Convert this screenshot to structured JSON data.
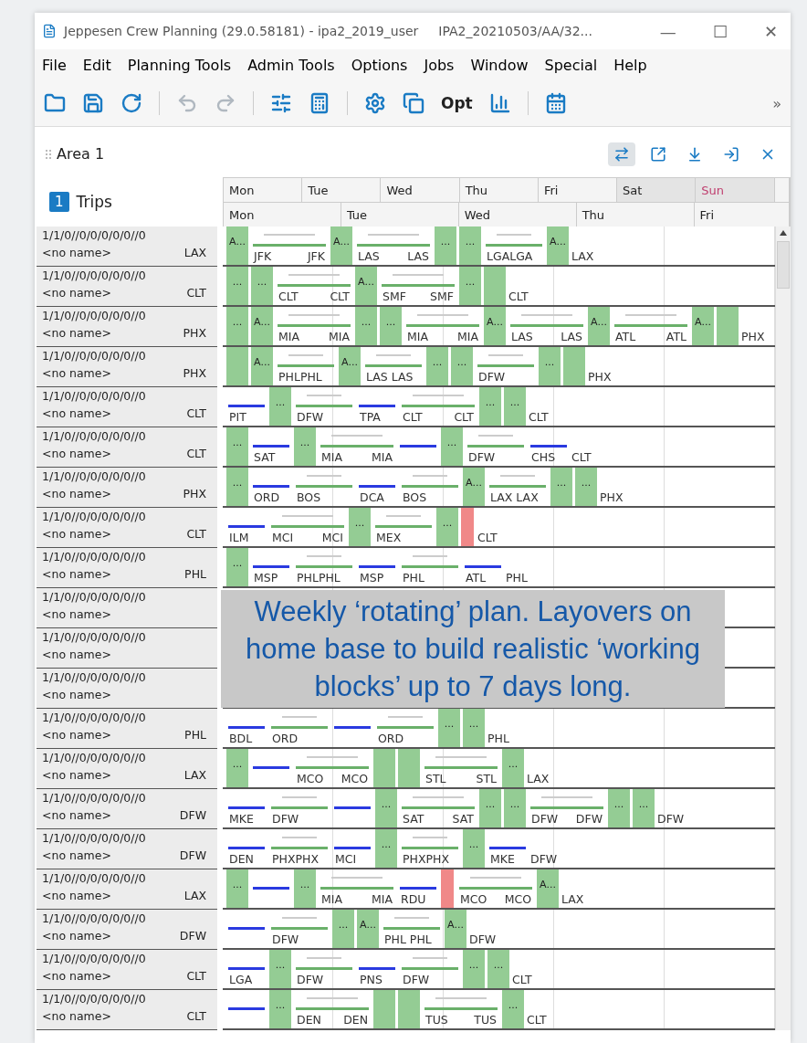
{
  "window": {
    "title": "Jeppesen Crew Planning (29.0.58181) - ipa2_2019_user",
    "subtitle": "IPA2_20210503/AA/32...",
    "controls": [
      "—",
      "☐",
      "✕"
    ]
  },
  "menu": [
    "File",
    "Edit",
    "Planning Tools",
    "Admin Tools",
    "Options",
    "Jobs",
    "Window",
    "Special",
    "Help"
  ],
  "toolbar": {
    "items": [
      {
        "kind": "icon",
        "disabled": false
      },
      {
        "kind": "icon",
        "disabled": false
      },
      {
        "kind": "icon",
        "disabled": false
      },
      {
        "kind": "sep"
      },
      {
        "kind": "icon",
        "disabled": true
      },
      {
        "kind": "icon",
        "disabled": true
      },
      {
        "kind": "sep"
      },
      {
        "kind": "icon",
        "disabled": false
      },
      {
        "kind": "icon",
        "disabled": false
      },
      {
        "kind": "sep"
      },
      {
        "kind": "icon",
        "disabled": false
      },
      {
        "kind": "icon",
        "disabled": false
      },
      {
        "kind": "text",
        "label": "Opt"
      },
      {
        "kind": "icon",
        "disabled": false
      },
      {
        "kind": "sep"
      },
      {
        "kind": "icon",
        "disabled": false
      }
    ],
    "overflow": "»"
  },
  "area": {
    "title": "Area 1",
    "actions": [
      {
        "selected": true
      },
      {
        "selected": false
      },
      {
        "selected": false
      },
      {
        "selected": false
      },
      {
        "selected": false
      }
    ]
  },
  "trips": {
    "badge": "1",
    "label": "Trips"
  },
  "ruler": {
    "top": [
      {
        "label": "Mon",
        "weekend": false
      },
      {
        "label": "Tue",
        "weekend": false
      },
      {
        "label": "Wed",
        "weekend": false
      },
      {
        "label": "Thu",
        "weekend": false
      },
      {
        "label": "Fri",
        "weekend": false
      },
      {
        "label": "Sat",
        "weekend": true
      },
      {
        "label": "Sun",
        "weekend": true,
        "holiday": true
      }
    ],
    "bottom": [
      "Mon",
      "Tue",
      "Wed",
      "Thu",
      "Fri"
    ]
  },
  "rows": [
    {
      "id": "1/1/0//0/0/0/0/0//0",
      "name": "<no name>",
      "base": "LAX",
      "segments": [
        {
          "kind": "duty",
          "text": "A..."
        },
        {
          "kind": "trip",
          "labels": [
            "JFK",
            "JFK"
          ]
        },
        {
          "kind": "duty",
          "text": "A..."
        },
        {
          "kind": "trip",
          "labels": [
            "LAS",
            "LAS"
          ]
        },
        {
          "kind": "duty",
          "text": "..."
        },
        {
          "kind": "duty",
          "text": "..."
        },
        {
          "kind": "trip",
          "labels": [
            "LGALGA"
          ]
        },
        {
          "kind": "duty",
          "text": "A..."
        },
        {
          "kind": "end",
          "text": "LAX"
        }
      ]
    },
    {
      "id": "1/1/0//0/0/0/0/0//0",
      "name": "<no name>",
      "base": "CLT",
      "segments": [
        {
          "kind": "duty",
          "text": "..."
        },
        {
          "kind": "duty",
          "text": "..."
        },
        {
          "kind": "trip",
          "labels": [
            "CLT",
            "CLT"
          ]
        },
        {
          "kind": "duty",
          "text": "A..."
        },
        {
          "kind": "trip",
          "labels": [
            "SMF",
            "SMF"
          ]
        },
        {
          "kind": "duty",
          "text": "..."
        },
        {
          "kind": "duty"
        },
        {
          "kind": "end",
          "text": "CLT"
        }
      ]
    },
    {
      "id": "1/1/0//0/0/0/0/0//0",
      "name": "<no name>",
      "base": "PHX",
      "segments": [
        {
          "kind": "duty",
          "text": "..."
        },
        {
          "kind": "duty",
          "text": "A..."
        },
        {
          "kind": "trip",
          "labels": [
            "MIA",
            "MIA"
          ]
        },
        {
          "kind": "duty",
          "text": "..."
        },
        {
          "kind": "duty",
          "text": "..."
        },
        {
          "kind": "trip",
          "labels": [
            "MIA",
            "MIA"
          ]
        },
        {
          "kind": "duty",
          "text": "A..."
        },
        {
          "kind": "trip",
          "labels": [
            "LAS",
            "LAS"
          ]
        },
        {
          "kind": "duty",
          "text": "A..."
        },
        {
          "kind": "trip",
          "labels": [
            "ATL",
            "ATL"
          ]
        },
        {
          "kind": "duty",
          "text": "A..."
        },
        {
          "kind": "duty"
        },
        {
          "kind": "end",
          "text": "PHX"
        }
      ]
    },
    {
      "id": "1/1/0//0/0/0/0/0//0",
      "name": "<no name>",
      "base": "PHX",
      "segments": [
        {
          "kind": "duty"
        },
        {
          "kind": "duty",
          "text": "A..."
        },
        {
          "kind": "trip",
          "labels": [
            "PHLPHL"
          ]
        },
        {
          "kind": "duty",
          "text": "A..."
        },
        {
          "kind": "trip",
          "labels": [
            "LAS LAS"
          ]
        },
        {
          "kind": "duty",
          "text": "..."
        },
        {
          "kind": "duty",
          "text": "..."
        },
        {
          "kind": "trip",
          "labels": [
            "DFW"
          ]
        },
        {
          "kind": "duty",
          "text": "..."
        },
        {
          "kind": "duty"
        },
        {
          "kind": "end",
          "text": "PHX"
        }
      ]
    },
    {
      "id": "1/1/0//0/0/0/0/0//0",
      "name": "<no name>",
      "base": "CLT",
      "segments": [
        {
          "kind": "hop",
          "text": "PIT"
        },
        {
          "kind": "duty",
          "text": "..."
        },
        {
          "kind": "trip",
          "labels": [
            "DFW"
          ]
        },
        {
          "kind": "hop",
          "text": "TPA"
        },
        {
          "kind": "trip",
          "labels": [
            "CLT",
            "CLT"
          ]
        },
        {
          "kind": "duty",
          "text": "..."
        },
        {
          "kind": "duty",
          "text": "..."
        },
        {
          "kind": "end",
          "text": "CLT"
        }
      ]
    },
    {
      "id": "1/1/0//0/0/0/0/0//0",
      "name": "<no name>",
      "base": "CLT",
      "segments": [
        {
          "kind": "duty",
          "text": "..."
        },
        {
          "kind": "hop",
          "text": "SAT"
        },
        {
          "kind": "duty",
          "text": "..."
        },
        {
          "kind": "trip",
          "labels": [
            "MIA",
            "MIA"
          ]
        },
        {
          "kind": "hop"
        },
        {
          "kind": "duty",
          "text": "..."
        },
        {
          "kind": "trip",
          "labels": [
            "DFW"
          ]
        },
        {
          "kind": "hop",
          "text": "CHS"
        },
        {
          "kind": "end",
          "text": "CLT"
        }
      ]
    },
    {
      "id": "1/1/0//0/0/0/0/0//0",
      "name": "<no name>",
      "base": "PHX",
      "segments": [
        {
          "kind": "duty",
          "text": "..."
        },
        {
          "kind": "hop",
          "text": "ORD"
        },
        {
          "kind": "trip",
          "labels": [
            "BOS"
          ]
        },
        {
          "kind": "hop",
          "text": "DCA"
        },
        {
          "kind": "trip",
          "labels": [
            "BOS"
          ]
        },
        {
          "kind": "duty",
          "text": "A..."
        },
        {
          "kind": "trip",
          "labels": [
            "LAX LAX"
          ]
        },
        {
          "kind": "duty",
          "text": "..."
        },
        {
          "kind": "duty",
          "text": "..."
        },
        {
          "kind": "end",
          "text": "PHX"
        }
      ]
    },
    {
      "id": "1/1/0//0/0/0/0/0//0",
      "name": "<no name>",
      "base": "CLT",
      "segments": [
        {
          "kind": "hop",
          "text": "ILM"
        },
        {
          "kind": "trip",
          "labels": [
            "MCI",
            "MCI"
          ]
        },
        {
          "kind": "duty",
          "text": "..."
        },
        {
          "kind": "trip",
          "labels": [
            "MEX"
          ]
        },
        {
          "kind": "duty",
          "text": "..."
        },
        {
          "kind": "conflict"
        },
        {
          "kind": "end",
          "text": "CLT"
        }
      ]
    },
    {
      "id": "1/1/0//0/0/0/0/0//0",
      "name": "<no name>",
      "base": "PHL",
      "segments": [
        {
          "kind": "duty",
          "text": "..."
        },
        {
          "kind": "hop",
          "text": "MSP"
        },
        {
          "kind": "trip",
          "labels": [
            "PHLPHL"
          ]
        },
        {
          "kind": "hop",
          "text": "MSP"
        },
        {
          "kind": "trip",
          "labels": [
            "PHL"
          ]
        },
        {
          "kind": "hop",
          "text": "ATL"
        },
        {
          "kind": "end",
          "text": "PHL"
        }
      ]
    },
    {
      "id": "1/1/0//0/0/0/0/0//0",
      "name": "<no name>"
    },
    {
      "id": "1/1/0//0/0/0/0/0//0",
      "name": "<no name>"
    },
    {
      "id": "1/1/0//0/0/0/0/0//0",
      "name": "<no name>"
    },
    {
      "id": "1/1/0//0/0/0/0/0//0",
      "name": "<no name>",
      "base": "PHL",
      "segments": [
        {
          "kind": "hop",
          "text": "BDL"
        },
        {
          "kind": "trip",
          "labels": [
            "ORD"
          ]
        },
        {
          "kind": "hop"
        },
        {
          "kind": "trip",
          "labels": [
            "ORD"
          ]
        },
        {
          "kind": "duty",
          "text": "..."
        },
        {
          "kind": "duty",
          "text": "..."
        },
        {
          "kind": "end",
          "text": "PHL"
        }
      ]
    },
    {
      "id": "1/1/0//0/0/0/0/0//0",
      "name": "<no name>",
      "base": "LAX",
      "segments": [
        {
          "kind": "duty",
          "text": "..."
        },
        {
          "kind": "hop"
        },
        {
          "kind": "trip",
          "labels": [
            "MCO",
            "MCO"
          ]
        },
        {
          "kind": "duty"
        },
        {
          "kind": "duty"
        },
        {
          "kind": "trip",
          "labels": [
            "STL",
            "STL"
          ]
        },
        {
          "kind": "duty",
          "text": "..."
        },
        {
          "kind": "end",
          "text": "LAX"
        }
      ]
    },
    {
      "id": "1/1/0//0/0/0/0/0//0",
      "name": "<no name>",
      "base": "DFW",
      "segments": [
        {
          "kind": "hop",
          "text": "MKE"
        },
        {
          "kind": "trip",
          "labels": [
            "DFW"
          ]
        },
        {
          "kind": "hop"
        },
        {
          "kind": "duty",
          "text": "..."
        },
        {
          "kind": "trip",
          "labels": [
            "SAT",
            "SAT"
          ]
        },
        {
          "kind": "duty",
          "text": "..."
        },
        {
          "kind": "duty",
          "text": "..."
        },
        {
          "kind": "trip",
          "labels": [
            "DFW",
            "DFW"
          ]
        },
        {
          "kind": "duty",
          "text": "..."
        },
        {
          "kind": "duty",
          "text": "..."
        },
        {
          "kind": "end",
          "text": "DFW"
        }
      ]
    },
    {
      "id": "1/1/0//0/0/0/0/0//0",
      "name": "<no name>",
      "base": "DFW",
      "segments": [
        {
          "kind": "hop",
          "text": "DEN"
        },
        {
          "kind": "trip",
          "labels": [
            "PHXPHX"
          ]
        },
        {
          "kind": "hop",
          "text": "MCI"
        },
        {
          "kind": "duty",
          "text": "..."
        },
        {
          "kind": "trip",
          "labels": [
            "PHXPHX"
          ]
        },
        {
          "kind": "duty",
          "text": "..."
        },
        {
          "kind": "hop",
          "text": "MKE"
        },
        {
          "kind": "end",
          "text": "DFW"
        }
      ]
    },
    {
      "id": "1/1/0//0/0/0/0/0//0",
      "name": "<no name>",
      "base": "LAX",
      "segments": [
        {
          "kind": "duty",
          "text": "..."
        },
        {
          "kind": "hop"
        },
        {
          "kind": "duty",
          "text": "..."
        },
        {
          "kind": "trip",
          "labels": [
            "MIA",
            "MIA"
          ]
        },
        {
          "kind": "hop",
          "text": "RDU"
        },
        {
          "kind": "conflict"
        },
        {
          "kind": "trip",
          "labels": [
            "MCO",
            "MCO"
          ]
        },
        {
          "kind": "duty",
          "text": "A..."
        },
        {
          "kind": "end",
          "text": "LAX"
        }
      ]
    },
    {
      "id": "1/1/0//0/0/0/0/0//0",
      "name": "<no name>",
      "base": "DFW",
      "segments": [
        {
          "kind": "hop"
        },
        {
          "kind": "trip",
          "labels": [
            "DFW"
          ]
        },
        {
          "kind": "duty",
          "text": "..."
        },
        {
          "kind": "duty",
          "text": "A..."
        },
        {
          "kind": "trip",
          "labels": [
            "PHL PHL"
          ]
        },
        {
          "kind": "duty",
          "text": "A..."
        },
        {
          "kind": "end",
          "text": "DFW"
        }
      ]
    },
    {
      "id": "1/1/0//0/0/0/0/0//0",
      "name": "<no name>",
      "base": "CLT",
      "segments": [
        {
          "kind": "hop",
          "text": "LGA"
        },
        {
          "kind": "duty",
          "text": "..."
        },
        {
          "kind": "trip",
          "labels": [
            "DFW"
          ]
        },
        {
          "kind": "hop",
          "text": "PNS"
        },
        {
          "kind": "trip",
          "labels": [
            "DFW"
          ]
        },
        {
          "kind": "duty",
          "text": "..."
        },
        {
          "kind": "duty",
          "text": "..."
        },
        {
          "kind": "end",
          "text": "CLT"
        }
      ]
    },
    {
      "id": "1/1/0//0/0/0/0/0//0",
      "name": "<no name>",
      "base": "CLT",
      "segments": [
        {
          "kind": "hop"
        },
        {
          "kind": "duty",
          "text": "..."
        },
        {
          "kind": "trip",
          "labels": [
            "DEN",
            "DEN"
          ]
        },
        {
          "kind": "duty"
        },
        {
          "kind": "duty"
        },
        {
          "kind": "trip",
          "labels": [
            "TUS",
            "TUS"
          ]
        },
        {
          "kind": "duty",
          "text": "..."
        },
        {
          "kind": "end",
          "text": "CLT"
        }
      ]
    }
  ],
  "caption": "Weekly ‘rotating’ plan. Layovers on home base to build realistic ‘working blocks’ up to 7 days long."
}
